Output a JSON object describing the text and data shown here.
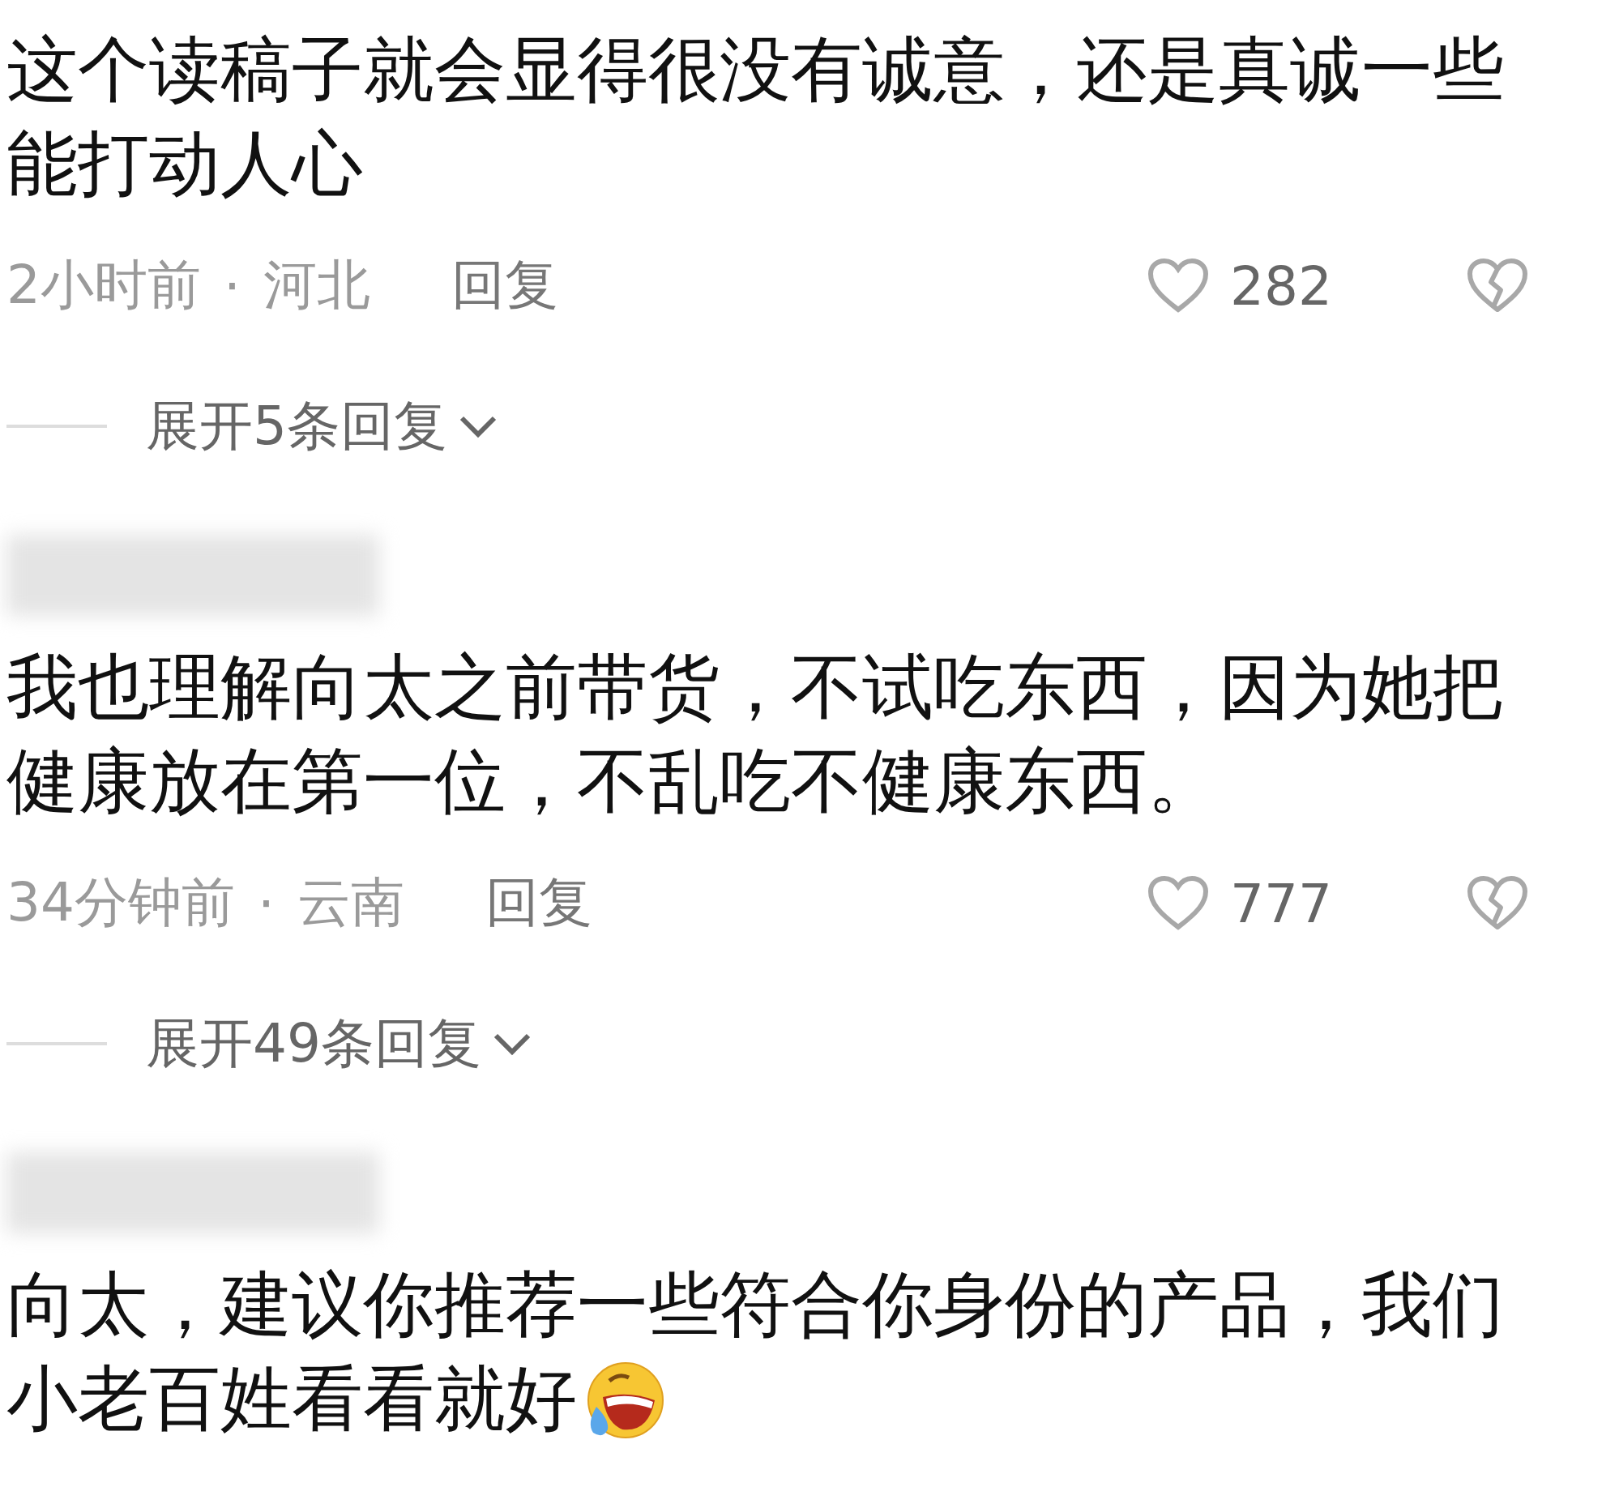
{
  "comments": [
    {
      "lines": [
        "这个读稿子就会显得很没有诚意，还是真诚一些",
        "能打动人心"
      ],
      "meta": {
        "time": "2小时前",
        "separator": "·",
        "location": "河北",
        "reply": "回复",
        "likes": "282"
      },
      "expand": "展开5条回复"
    },
    {
      "username_blurred": true,
      "lines": [
        "我也理解向太之前带货，不试吃东西，因为她把",
        "健康放在第一位，不乱吃不健康东西。"
      ],
      "meta": {
        "time": "34分钟前",
        "separator": "·",
        "location": "云南",
        "reply": "回复",
        "likes": "777"
      },
      "expand": "展开49条回复"
    },
    {
      "username_blurred": true,
      "lines": [
        "向太，建议你推荐一些符合你身份的产品，我们",
        "小老百姓看看就好"
      ],
      "has_emoji": true
    }
  ]
}
